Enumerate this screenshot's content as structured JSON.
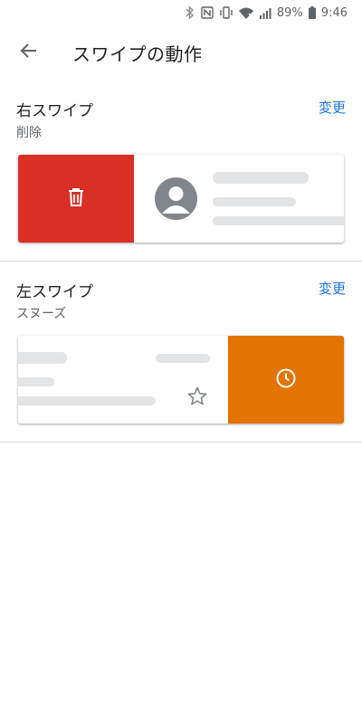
{
  "status_bar": {
    "battery_percent": "89%",
    "time": "9:46"
  },
  "app_bar": {
    "title": "スワイプの動作"
  },
  "right_swipe": {
    "title": "右スワイプ",
    "action": "削除",
    "change_label": "変更",
    "action_color": "#d93025",
    "action_icon": "delete-icon"
  },
  "left_swipe": {
    "title": "左スワイプ",
    "action": "スヌーズ",
    "change_label": "変更",
    "action_color": "#e37400",
    "action_icon": "clock-icon"
  },
  "colors": {
    "accent": "#1a73e8",
    "placeholder": "#e3e4e6"
  }
}
